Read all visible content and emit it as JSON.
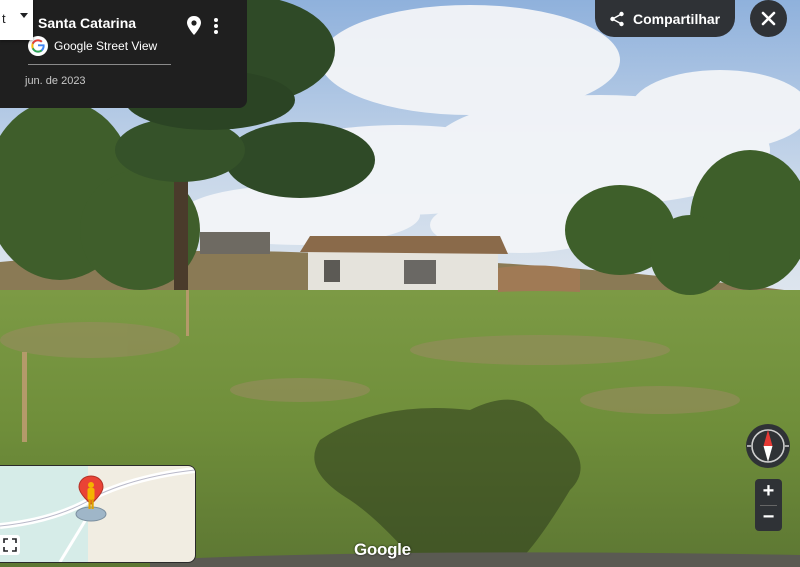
{
  "location": {
    "title": "Santa Catarina",
    "date": "jun. de 2023"
  },
  "dropdown": {
    "visible_text": "t"
  },
  "brand": {
    "product_label": "Google Street View",
    "watermark": "Google"
  },
  "toolbar": {
    "share_label": "Compartilhar"
  },
  "zoom": {
    "in_label": "+",
    "out_label": "−"
  },
  "icons": {
    "pin": "location-pin-icon",
    "more": "more-vert-icon",
    "google": "google-g-icon",
    "share": "share-icon",
    "close": "close-icon",
    "compass": "compass-icon",
    "expand": "expand-icon",
    "pegman": "pegman-icon"
  },
  "colors": {
    "panel": "#1f1f1f",
    "button": "#2f3236",
    "compass_red": "#e53935",
    "pin_red": "#ea4335",
    "pegman": "#f4b400"
  }
}
